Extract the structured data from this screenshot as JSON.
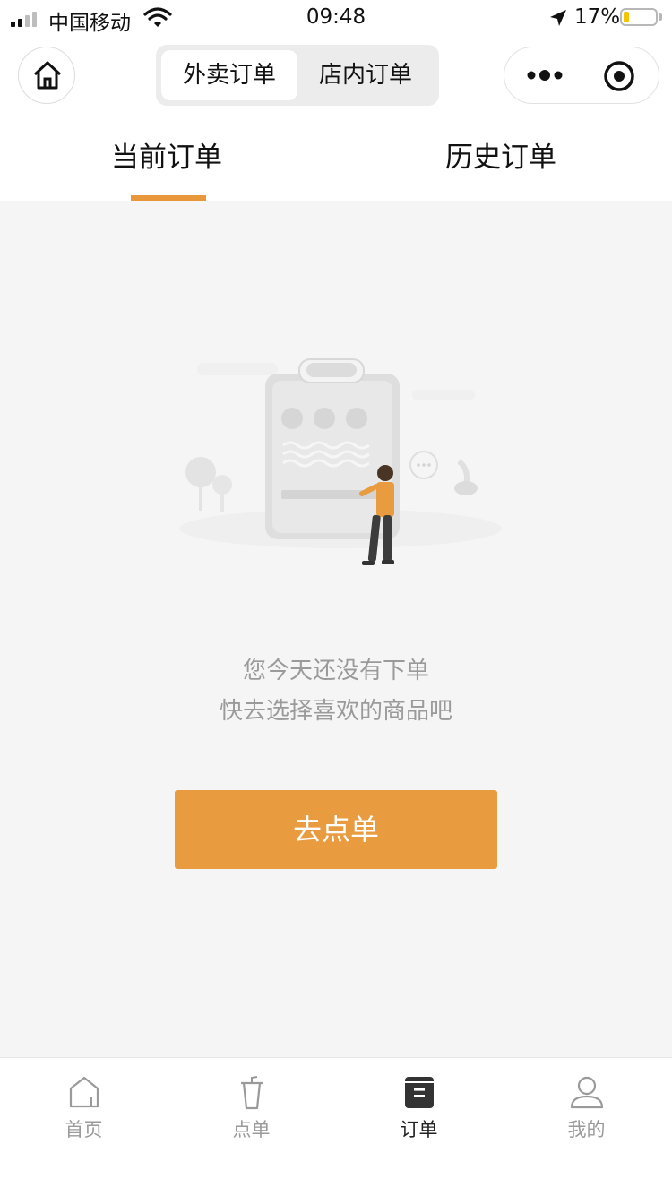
{
  "status_bar": {
    "carrier": "中国移动",
    "time": "09:48",
    "battery": "17%",
    "battery_level": 0.17,
    "icons": [
      "signal-icon",
      "wifi-icon",
      "location-arrow-icon",
      "battery-icon"
    ]
  },
  "navbar": {
    "home_icon": "home-icon",
    "segments": [
      {
        "label": "外卖订单",
        "active": true
      },
      {
        "label": "店内订单",
        "active": false
      }
    ],
    "capsule_icons": [
      "more-icon",
      "close-miniprogram-icon"
    ]
  },
  "subtabs": [
    {
      "label": "当前订单",
      "active": true
    },
    {
      "label": "历史订单",
      "active": false
    }
  ],
  "colors": {
    "accent": "#e99b3f",
    "background": "#f5f5f5",
    "muted_text": "#9a9a9a"
  },
  "empty_state": {
    "illustration": "empty-order-illustration",
    "line1": "您今天还没有下单",
    "line2": "快去选择喜欢的商品吧",
    "button_label": "去点单"
  },
  "tabbar": {
    "items": [
      {
        "label": "首页",
        "icon": "home-icon",
        "active": false
      },
      {
        "label": "点单",
        "icon": "cup-icon",
        "active": false
      },
      {
        "label": "订单",
        "icon": "order-icon",
        "active": true
      },
      {
        "label": "我的",
        "icon": "profile-icon",
        "active": false
      }
    ]
  }
}
